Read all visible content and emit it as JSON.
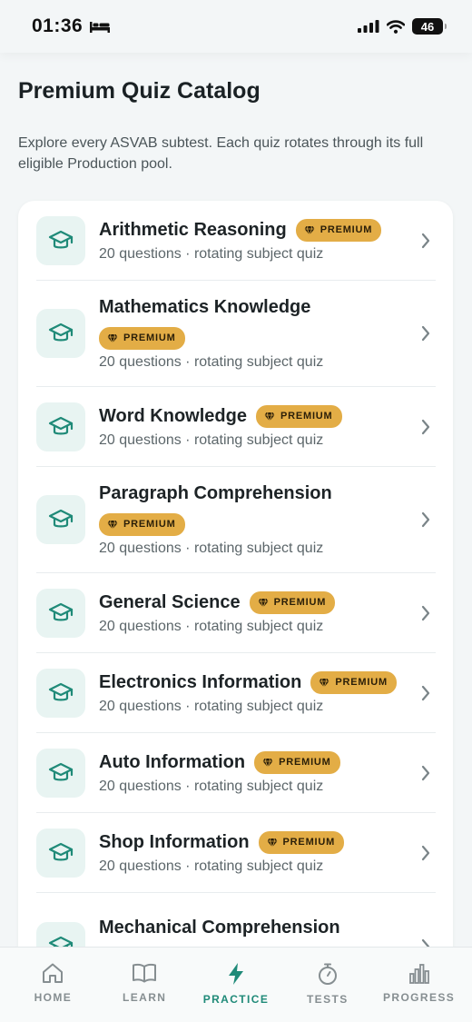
{
  "status_bar": {
    "time": "01:36",
    "battery": "46"
  },
  "header": {
    "title": "Premium Quiz Catalog",
    "subtitle": "Explore every ASVAB subtest. Each quiz rotates through its full eligible Production pool."
  },
  "badge_label": "PREMIUM",
  "quizzes": [
    {
      "title": "Arithmetic Reasoning",
      "subtitle": "20 questions · rotating subject quiz"
    },
    {
      "title": "Mathematics Knowledge",
      "subtitle": "20 questions · rotating subject quiz"
    },
    {
      "title": "Word Knowledge",
      "subtitle": "20 questions · rotating subject quiz"
    },
    {
      "title": "Paragraph Comprehension",
      "subtitle": "20 questions · rotating subject quiz"
    },
    {
      "title": "General Science",
      "subtitle": "20 questions · rotating subject quiz"
    },
    {
      "title": "Electronics Information",
      "subtitle": "20 questions · rotating subject quiz"
    },
    {
      "title": "Auto Information",
      "subtitle": "20 questions · rotating subject quiz"
    },
    {
      "title": "Shop Information",
      "subtitle": "20 questions · rotating subject quiz"
    },
    {
      "title": "Mechanical Comprehension",
      "subtitle": ""
    }
  ],
  "tabs": [
    {
      "label": "HOME",
      "icon": "home-icon"
    },
    {
      "label": "LEARN",
      "icon": "book-icon"
    },
    {
      "label": "PRACTICE",
      "icon": "bolt-icon",
      "active": true
    },
    {
      "label": "TESTS",
      "icon": "stopwatch-icon"
    },
    {
      "label": "PROGRESS",
      "icon": "bar-chart-icon"
    }
  ],
  "colors": {
    "accent": "#1f8a78",
    "badge": "#e3ad46",
    "icon_bg": "#e8f4f2"
  }
}
